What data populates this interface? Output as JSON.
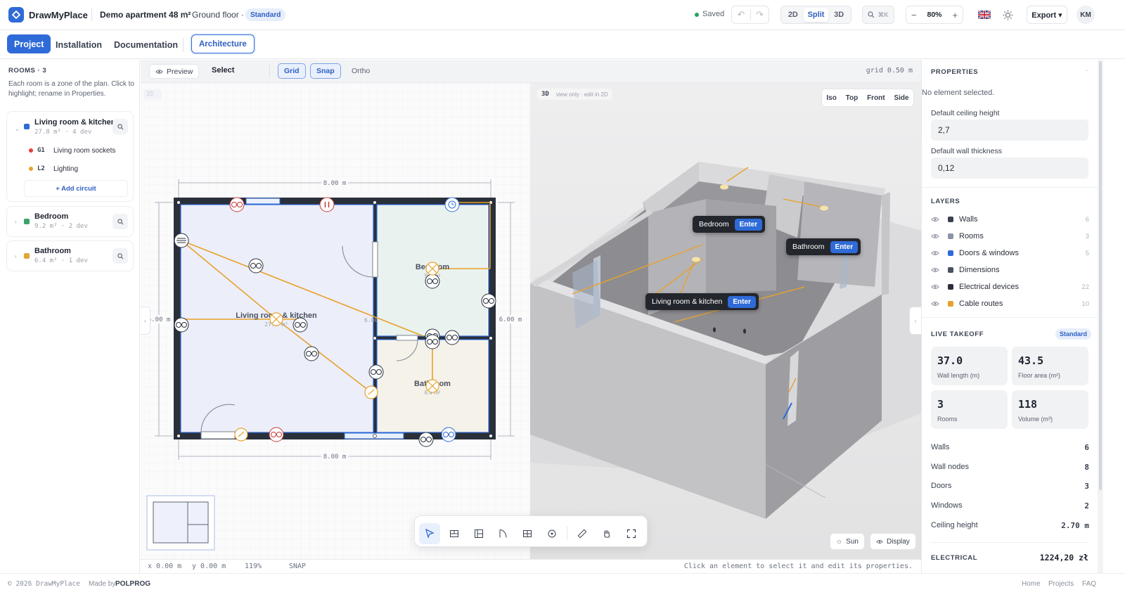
{
  "app": {
    "name": "DrawMyPlace",
    "project": "Demo apartment 48 m²",
    "separator": "/",
    "floor": "Ground floor ·",
    "plan": "Standard"
  },
  "header": {
    "saved": "Saved",
    "view_modes": [
      "2D",
      "Split",
      "3D"
    ],
    "active_view": "Split",
    "search_shortcut": "⌘K",
    "zoom_minus": "−",
    "zoom": "80%",
    "zoom_plus": "+",
    "export": "Export ▾",
    "avatar": "KM",
    "language_flag": "uk-flag-icon",
    "colors": {
      "accent": "#2f6bd8",
      "saved_dot": "#22a55b"
    }
  },
  "tabs": [
    {
      "label": "Project",
      "active": true
    },
    {
      "label": "Installation",
      "active": false
    },
    {
      "label": "Documentation",
      "active": false
    }
  ],
  "mode_tab": "Architecture",
  "rooms": {
    "title": "ROOMS · 3",
    "help": "Each room is a zone of the plan. Click to highlight; rename in Properties.",
    "items": [
      {
        "name": "Living room & kitchen",
        "meta": "27.8 m² · 4 dev",
        "color": "#2f6bd8",
        "circuits": [
          {
            "code": "G1",
            "name": "Living room sockets",
            "color": "#e0413a"
          },
          {
            "code": "L2",
            "name": "Lighting",
            "color": "#e8a22a"
          }
        ],
        "add": "+ Add circuit"
      },
      {
        "name": "Bedroom",
        "meta": "9.2 m² · 2 dev",
        "color": "#3ba36b"
      },
      {
        "name": "Bathroom",
        "meta": "6.4 m² · 1 dev",
        "color": "#e0a63a"
      }
    ]
  },
  "toolbar": {
    "preview": "Preview",
    "select": "Select",
    "grid": "Grid",
    "snap": "Snap",
    "ortho": "Ortho",
    "grid_size": "grid 0.50 m"
  },
  "plan": {
    "badge": "2D",
    "dim_top": "8.00 m",
    "dim_bottom": "8.00 m",
    "dim_left": "6.00 m",
    "dim_right": "6.00 m",
    "dim_mid": "6.00",
    "room_living": "Living room & kitchen",
    "room_living_area": "27.8 m²",
    "room_bedroom": "Bedroom",
    "room_bedroom_area": "9.2 m²",
    "room_bathroom": "Bathroom",
    "room_bathroom_area": "6.4 m²"
  },
  "view3d": {
    "badge": "3D",
    "hint": "view only · edit in 2D",
    "cams": [
      "Iso",
      "Top",
      "Front",
      "Side"
    ],
    "labels": [
      {
        "name": "Bedroom",
        "action": "Enter"
      },
      {
        "name": "Bathroom",
        "action": "Enter"
      },
      {
        "name": "Living room & kitchen",
        "action": "Enter"
      }
    ],
    "sun": "Sun",
    "display": "Display"
  },
  "status": {
    "x": "x 0.00 m",
    "y": "y 0.00 m",
    "zoom": "119%",
    "snap": "SNAP",
    "hint": "Click an element to select it and edit its properties."
  },
  "properties": {
    "title": "PROPERTIES",
    "dot": "·",
    "none": "No element selected.",
    "ceiling_label": "Default ceiling height",
    "ceiling_value": "2,7",
    "wall_label": "Default wall thickness",
    "wall_value": "0,12"
  },
  "layers": {
    "title": "LAYERS",
    "items": [
      {
        "name": "Walls",
        "count": "6",
        "color": "#3a4150"
      },
      {
        "name": "Rooms",
        "count": "3",
        "color": "#8a93a6"
      },
      {
        "name": "Doors & windows",
        "count": "5",
        "color": "#2f6bd8"
      },
      {
        "name": "Dimensions",
        "count": "",
        "color": "#4a5160"
      },
      {
        "name": "Electrical devices",
        "count": "22",
        "color": "#2a2f3a"
      },
      {
        "name": "Cable routes",
        "count": "10",
        "color": "#e8a22a"
      }
    ]
  },
  "takeoff": {
    "title": "LIVE TAKEOFF",
    "badge": "Standard",
    "stats": [
      {
        "value": "37.0",
        "label": "Wall length (m)"
      },
      {
        "value": "43.5",
        "label": "Floor area (m²)"
      },
      {
        "value": "3",
        "label": "Rooms"
      },
      {
        "value": "118",
        "label": "Volume (m³)"
      }
    ],
    "rows": [
      {
        "k": "Walls",
        "v": "6"
      },
      {
        "k": "Wall nodes",
        "v": "8"
      },
      {
        "k": "Doors",
        "v": "3"
      },
      {
        "k": "Windows",
        "v": "2"
      },
      {
        "k": "Ceiling height",
        "v": "2.70 m"
      }
    ],
    "electrical_label": "ELECTRICAL",
    "electrical_value": "1224,20 zł"
  },
  "footer": {
    "copyright": "© 2026 DrawMyPlace",
    "made_by": "Made by",
    "company": "POLPROG",
    "links": [
      "Home",
      "Projects",
      "FAQ"
    ]
  }
}
